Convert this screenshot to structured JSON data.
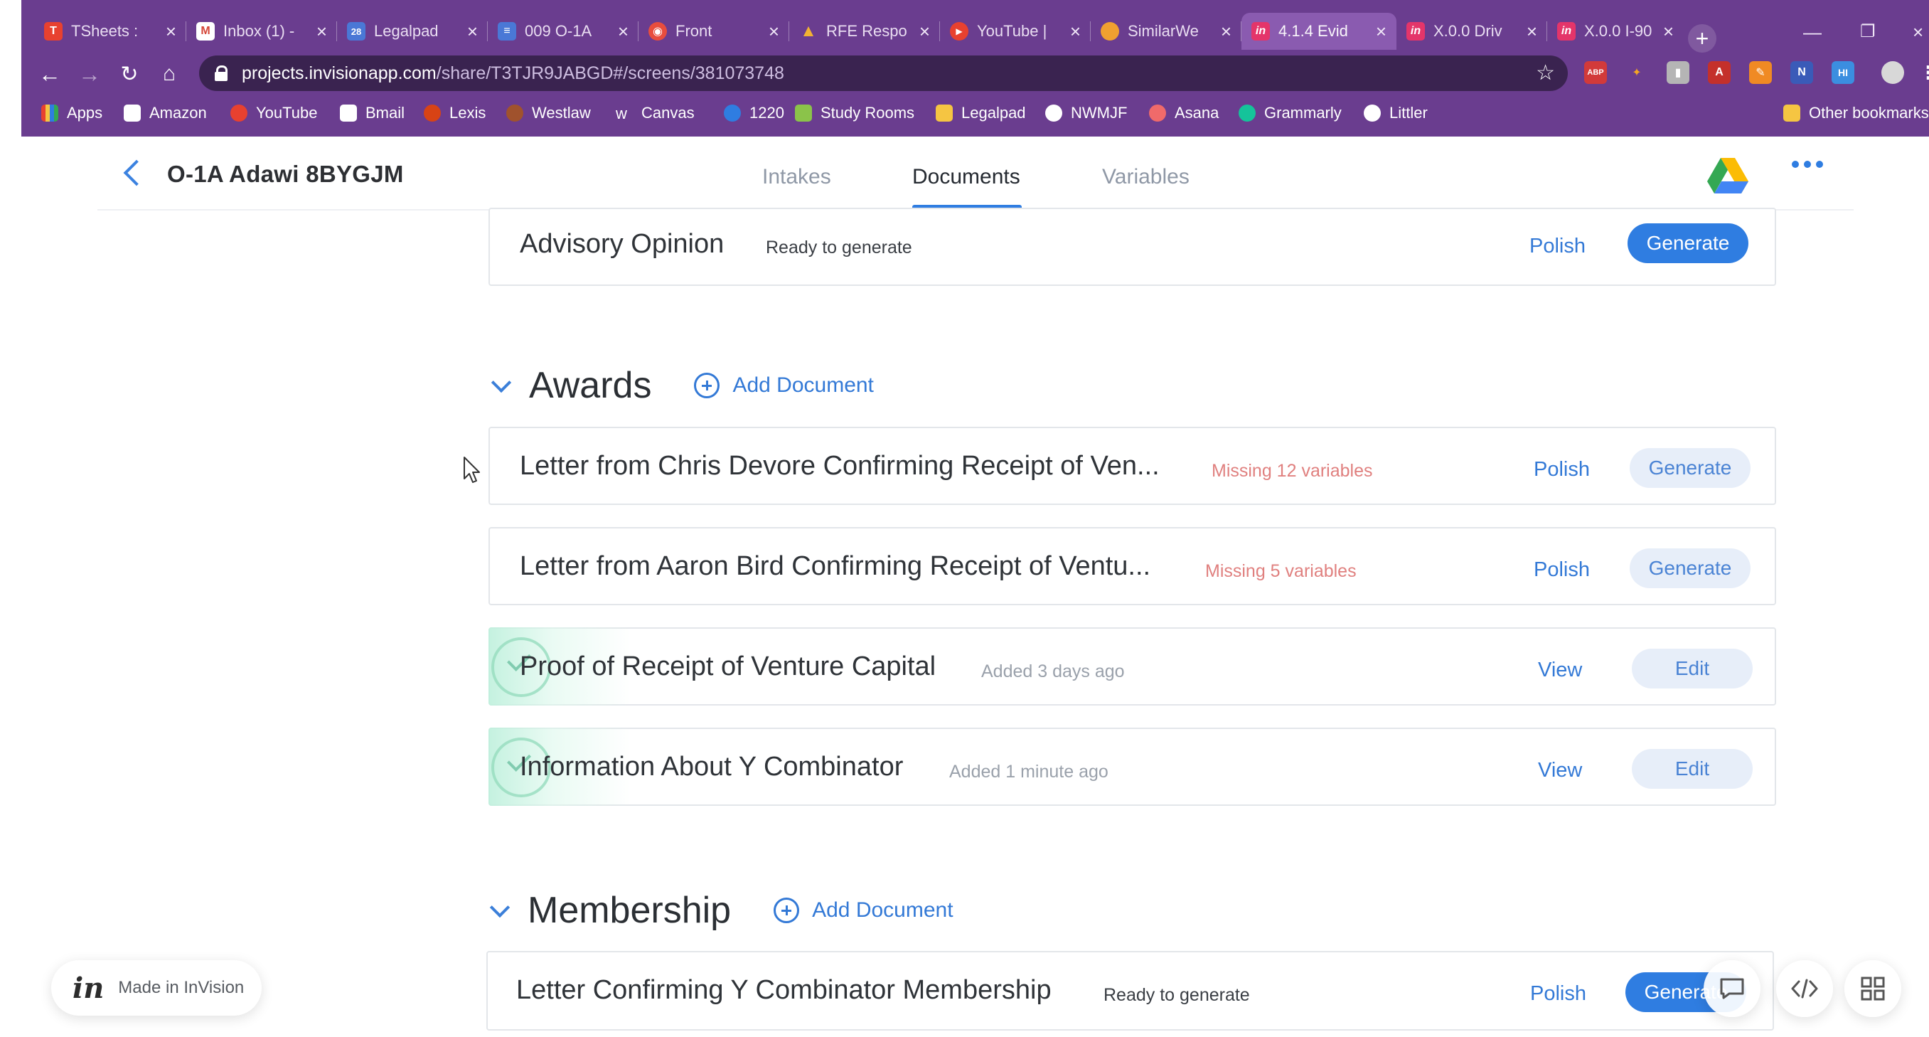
{
  "browser": {
    "tabs": [
      {
        "label": "TSheets :",
        "icon": "tsheets-icon",
        "color": "#e8412f"
      },
      {
        "label": "Inbox (1) -",
        "icon": "gmail-icon",
        "color": "#ffffff"
      },
      {
        "label": "Legalpad",
        "icon": "calendar-icon",
        "color": "#4a78d6"
      },
      {
        "label": "009 O-1A",
        "icon": "docs-icon",
        "color": "#4a78d6"
      },
      {
        "label": "Front",
        "icon": "front-icon",
        "color": "#e84d3d"
      },
      {
        "label": "RFE Respo",
        "icon": "drive-icon",
        "color": "#f2b233"
      },
      {
        "label": "YouTube |",
        "icon": "youtube-icon",
        "color": "#e8412f"
      },
      {
        "label": "SimilarWe",
        "icon": "similarweb-icon",
        "color": "#f0a030"
      },
      {
        "label": "4.1.4 Evid",
        "icon": "invision-icon",
        "color": "#e4356a"
      },
      {
        "label": "X.0.0 Driv",
        "icon": "invision-icon",
        "color": "#e4356a"
      },
      {
        "label": "X.0.0 I-90",
        "icon": "invision-icon",
        "color": "#e4356a"
      }
    ],
    "active_tab_index": 8,
    "url_host": "projects.invisionapp.com",
    "url_path": "/share/T3TJR9JABGD#/screens/381073748",
    "bookmarks": [
      {
        "label": "Apps",
        "color": "#e8412f"
      },
      {
        "label": "Amazon",
        "color": "#222222"
      },
      {
        "label": "YouTube",
        "color": "#e8412f"
      },
      {
        "label": "Bmail",
        "color": "#d44638"
      },
      {
        "label": "Lexis",
        "color": "#d84315"
      },
      {
        "label": "Westlaw",
        "color": "#a0522d"
      },
      {
        "label": "Canvas",
        "color": "#333333"
      },
      {
        "label": "1220",
        "color": "#2f7de1"
      },
      {
        "label": "Study Rooms",
        "color": "#8bc34a"
      },
      {
        "label": "Legalpad",
        "color": "#f5c542"
      },
      {
        "label": "NWMJF",
        "color": "#ffffff"
      },
      {
        "label": "Asana",
        "color": "#f06a6a"
      },
      {
        "label": "Grammarly",
        "color": "#15c39a"
      },
      {
        "label": "Littler",
        "color": "#ffffff"
      },
      {
        "label": "Other bookmarks",
        "color": "#f5c542"
      }
    ]
  },
  "header": {
    "project_title": "O-1A Adawi 8BYGJM",
    "tabs": [
      {
        "label": "Intakes",
        "active": false
      },
      {
        "label": "Documents",
        "active": true
      },
      {
        "label": "Variables",
        "active": false
      }
    ]
  },
  "top_card": {
    "name": "Advisory Opinion",
    "status": "Ready to generate",
    "link": "Polish",
    "button": "Generate"
  },
  "sections": [
    {
      "title": "Awards",
      "add_label": "Add Document",
      "items": [
        {
          "name": "Letter from Chris Devore Confirming Receipt of Ven...",
          "status": "Missing 12 variables",
          "status_kind": "missing",
          "link": "Polish",
          "button": "Generate",
          "done": false
        },
        {
          "name": "Letter from Aaron Bird Confirming Receipt of Ventu...",
          "status": "Missing 5 variables",
          "status_kind": "missing",
          "link": "Polish",
          "button": "Generate",
          "done": false
        },
        {
          "name": "Proof of Receipt of Venture Capital",
          "status": "Added 3 days ago",
          "status_kind": "added",
          "link": "View",
          "button": "Edit",
          "done": true
        },
        {
          "name": "Information About Y Combinator",
          "status": "Added 1 minute ago",
          "status_kind": "added",
          "link": "View",
          "button": "Edit",
          "done": true
        }
      ]
    },
    {
      "title": "Membership",
      "add_label": "Add Document",
      "items": [
        {
          "name": "Letter Confirming Y Combinator Membership",
          "status": "Ready to generate",
          "status_kind": "ready",
          "link": "Polish",
          "button": "Generate",
          "done": false
        }
      ]
    }
  ],
  "overlay": {
    "badge_logo": "in",
    "badge_text": "Made in InVision"
  },
  "colors": {
    "browser_bg": "#6a3d8f",
    "accent": "#2f7de1",
    "missing": "#e0807f"
  }
}
